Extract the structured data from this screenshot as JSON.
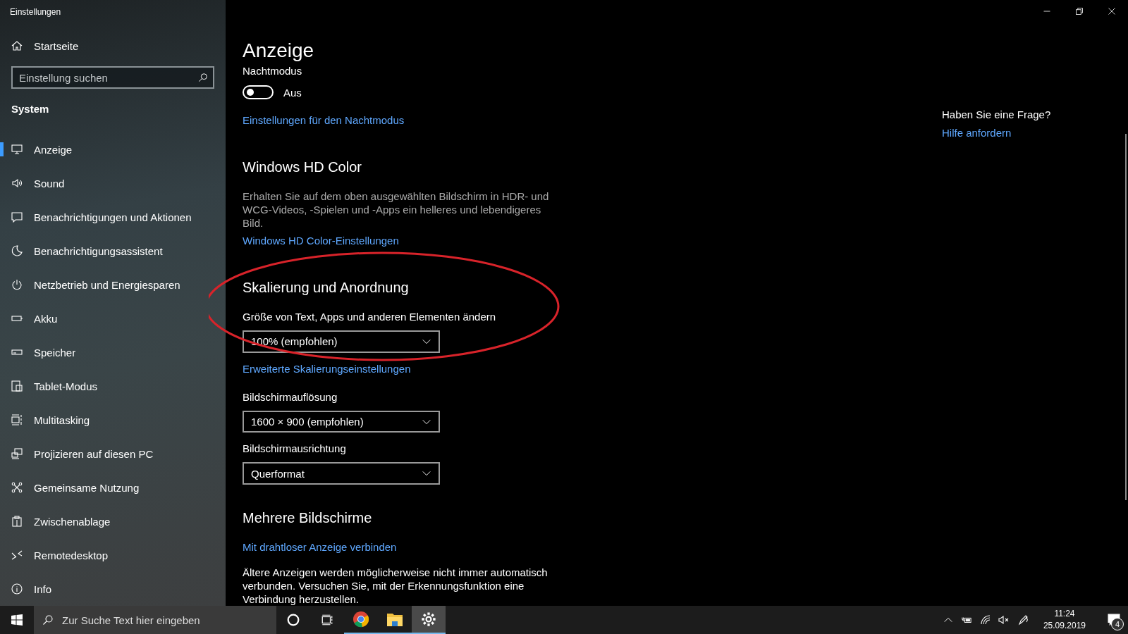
{
  "window": {
    "title": "Einstellungen"
  },
  "sidebar": {
    "home": "Startseite",
    "search": {
      "placeholder": "Einstellung suchen"
    },
    "section": "System",
    "items": [
      {
        "label": "Anzeige",
        "kind": "display",
        "selected": true
      },
      {
        "label": "Sound",
        "kind": "sound",
        "selected": false
      },
      {
        "label": "Benachrichtigungen und Aktionen",
        "kind": "message",
        "selected": false
      },
      {
        "label": "Benachrichtigungsassistent",
        "kind": "moon",
        "selected": false
      },
      {
        "label": "Netzbetrieb und Energiesparen",
        "kind": "power",
        "selected": false
      },
      {
        "label": "Akku",
        "kind": "battery",
        "selected": false
      },
      {
        "label": "Speicher",
        "kind": "storage",
        "selected": false
      },
      {
        "label": "Tablet-Modus",
        "kind": "tablet",
        "selected": false
      },
      {
        "label": "Multitasking",
        "kind": "multitask",
        "selected": false
      },
      {
        "label": "Projizieren auf diesen PC",
        "kind": "project",
        "selected": false
      },
      {
        "label": "Gemeinsame Nutzung",
        "kind": "share",
        "selected": false
      },
      {
        "label": "Zwischenablage",
        "kind": "clipboard",
        "selected": false
      },
      {
        "label": "Remotedesktop",
        "kind": "remote",
        "selected": false
      },
      {
        "label": "Info",
        "kind": "info",
        "selected": false
      }
    ]
  },
  "main": {
    "title": "Anzeige",
    "blocks": [
      {
        "kind": "label",
        "text": "Nachtmodus"
      },
      {
        "kind": "toggle",
        "on": false,
        "text": "Aus"
      },
      {
        "kind": "link",
        "text": "Einstellungen für den Nachtmodus"
      },
      {
        "kind": "heading",
        "text": "Windows HD Color"
      },
      {
        "kind": "paragraph",
        "text": "Erhalten Sie auf dem oben ausgewählten Bildschirm in HDR- und WCG-Videos, -Spielen und -Apps ein helleres und lebendigeres Bild.",
        "dim": true
      },
      {
        "kind": "link",
        "text": "Windows HD Color-Einstellungen"
      },
      {
        "kind": "heading",
        "text": "Skalierung und Anordnung"
      },
      {
        "kind": "label",
        "text": "Größe von Text, Apps und anderen Elementen ändern"
      },
      {
        "kind": "dropdown",
        "value": "100% (empfohlen)"
      },
      {
        "kind": "link",
        "text": "Erweiterte Skalierungseinstellungen"
      },
      {
        "kind": "label",
        "text": "Bildschirmauflösung"
      },
      {
        "kind": "dropdown",
        "value": "1600 × 900 (empfohlen)"
      },
      {
        "kind": "label",
        "text": "Bildschirmausrichtung"
      },
      {
        "kind": "dropdown",
        "value": "Querformat"
      },
      {
        "kind": "heading",
        "text": "Mehrere Bildschirme"
      },
      {
        "kind": "link",
        "text": "Mit drahtloser Anzeige verbinden"
      },
      {
        "kind": "paragraph",
        "text": "Ältere Anzeigen werden möglicherweise nicht immer automatisch verbunden. Versuchen Sie, mit der Erkennungsfunktion eine Verbindung herzustellen.",
        "dim": false
      }
    ]
  },
  "help": {
    "question": "Haben Sie eine Frage?",
    "link": "Hilfe anfordern"
  },
  "annotation": {
    "kind": "ellipse"
  },
  "taskbar": {
    "search": {
      "placeholder": "Zur Suche Text hier eingeben"
    },
    "apps": [
      {
        "kind": "cortana",
        "running": false,
        "selected": false
      },
      {
        "kind": "taskview",
        "running": false,
        "selected": false
      },
      {
        "kind": "chrome",
        "running": true,
        "selected": false
      },
      {
        "kind": "explorer",
        "running": true,
        "selected": false
      },
      {
        "kind": "settings",
        "running": true,
        "selected": true
      }
    ],
    "time": "11:24",
    "date": "25.09.2019",
    "notifications": "4"
  }
}
